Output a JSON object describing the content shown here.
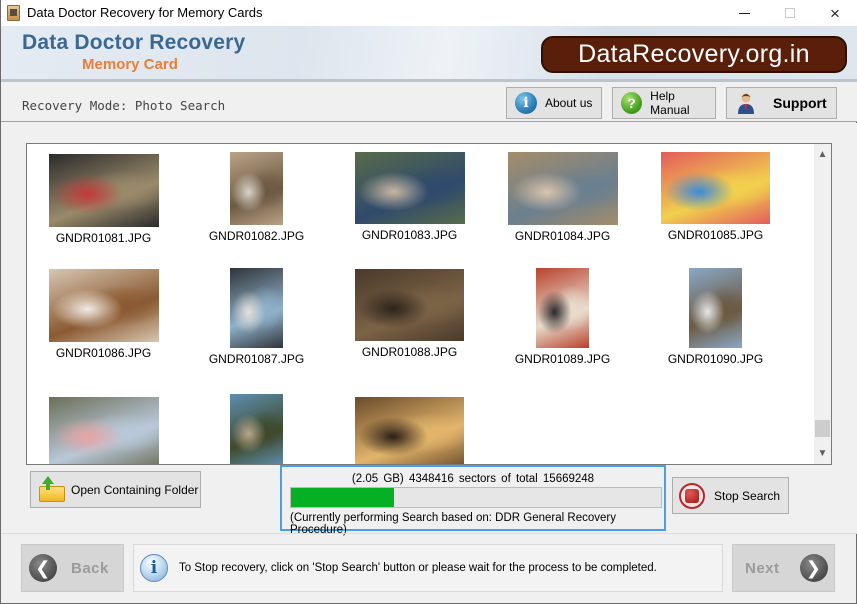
{
  "window": {
    "title": "Data Doctor Recovery for Memory Cards",
    "controls": {
      "minimize": "minimize",
      "maximize": "maximize",
      "close": "×"
    }
  },
  "banner": {
    "brand": "Data Doctor Recovery",
    "subtitle": "Memory Card",
    "website": "DataRecovery.org.in"
  },
  "mode": {
    "label": "Recovery Mode: Photo Search"
  },
  "top_buttons": {
    "about": "About us",
    "help": "Help Manual",
    "support": "Support"
  },
  "gallery": {
    "files": [
      {
        "name": "GNDR01081.JPG",
        "colors": [
          "#2b2b2b",
          "#9a8a6a",
          "#c43a3a"
        ]
      },
      {
        "name": "GNDR01082.JPG",
        "colors": [
          "#b9a488",
          "#6e5a43",
          "#d9d3c8"
        ]
      },
      {
        "name": "GNDR01083.JPG",
        "colors": [
          "#586c4a",
          "#2f4a6c",
          "#c8b7a2"
        ]
      },
      {
        "name": "GNDR01084.JPG",
        "colors": [
          "#a48d6a",
          "#6a7f8f",
          "#d9c4ad"
        ]
      },
      {
        "name": "GNDR01085.JPG",
        "colors": [
          "#e35c5c",
          "#f1d04d",
          "#3c8ad9"
        ]
      },
      {
        "name": "GNDR01086.JPG",
        "colors": [
          "#d7c6b1",
          "#8b5a32",
          "#f2ebe3"
        ]
      },
      {
        "name": "GNDR01087.JPG",
        "colors": [
          "#2f3439",
          "#8fb0c9",
          "#e6e1db"
        ]
      },
      {
        "name": "GNDR01088.JPG",
        "colors": [
          "#4a3a2a",
          "#7b6346",
          "#2c241b"
        ]
      },
      {
        "name": "GNDR01089.JPG",
        "colors": [
          "#b7422c",
          "#e9dccd",
          "#2a2a2a"
        ]
      },
      {
        "name": "GNDR01090.JPG",
        "colors": [
          "#8aa8c7",
          "#6c5a43",
          "#e7e7e7"
        ]
      },
      {
        "name": "",
        "colors": [
          "#6b6f58",
          "#b9c8d9",
          "#e9a4a4"
        ]
      },
      {
        "name": "",
        "colors": [
          "#5e8fb0",
          "#3f4a2c",
          "#b8a58a"
        ]
      },
      {
        "name": "",
        "colors": [
          "#6a4a2a",
          "#e2b56b",
          "#2b1f17"
        ]
      }
    ],
    "scroll_position": 0.9
  },
  "actions": {
    "open_folder": "Open Containing Folder",
    "stop_search": "Stop Search"
  },
  "progress": {
    "summary": "(2.05 GB) 4348416  sectors  of  total 15669248",
    "size": "2.05 GB",
    "sectors_done": 4348416,
    "sectors_total": 15669248,
    "fraction": 0.2775,
    "status": "(Currently performing Search based on:  DDR General Recovery Procedure)",
    "fill_color": "#06b025"
  },
  "footer": {
    "back": "Back",
    "next": "Next",
    "info": "To Stop recovery, click on 'Stop Search' button or please wait for the process to be completed."
  }
}
